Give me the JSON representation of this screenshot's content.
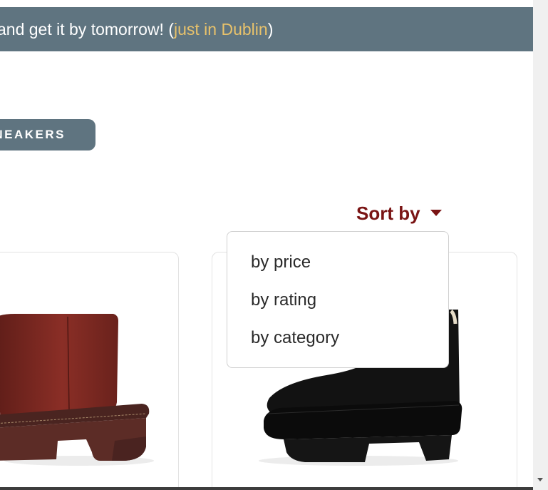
{
  "banner": {
    "text": "and get it by tomorrow! (",
    "highlight": "just in Dublin",
    "suffix": ")"
  },
  "category": {
    "label": "NEAKERS"
  },
  "sort": {
    "label": "Sort by",
    "options": [
      "by price",
      "by rating",
      "by category"
    ]
  },
  "products": [
    {
      "image": "burgundy-platform-ankle-boot",
      "color": "#7a2a22"
    },
    {
      "image": "black-suede-platform-ankle-boot",
      "color": "#111111"
    }
  ],
  "colors": {
    "banner_bg": "#5f7480",
    "banner_highlight": "#e8c26b",
    "sort_accent": "#7a1414"
  }
}
